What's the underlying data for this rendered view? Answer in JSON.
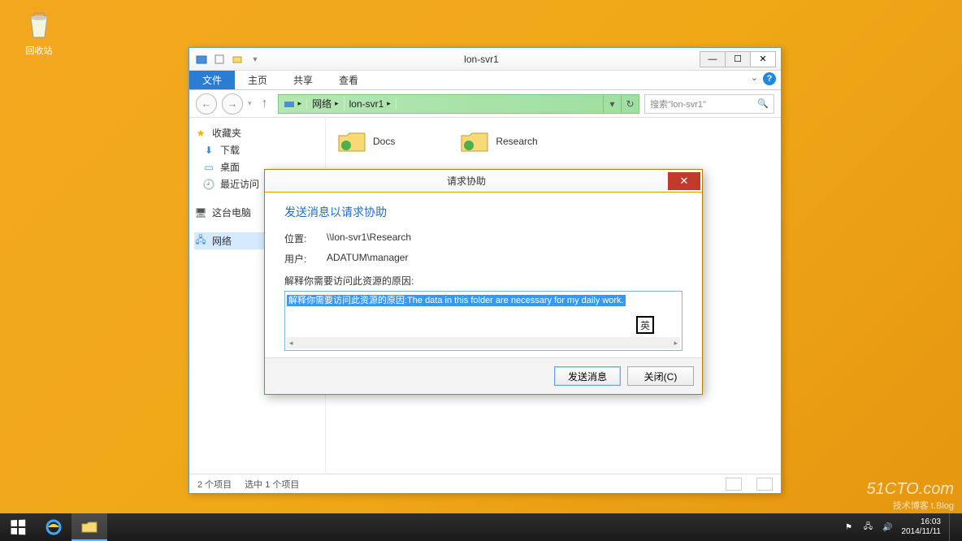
{
  "desktop": {
    "recycle_bin": "回收站"
  },
  "explorer": {
    "title": "lon-svr1",
    "ribbon": {
      "file": "文件",
      "home": "主页",
      "share": "共享",
      "view": "查看"
    },
    "addr": {
      "network": "网络",
      "host": "lon-svr1"
    },
    "search_placeholder": "搜索\"lon-svr1\"",
    "sidebar": {
      "favorites": "收藏夹",
      "downloads": "下载",
      "desktop": "桌面",
      "recent": "最近访问",
      "this_pc": "这台电脑",
      "network": "网络"
    },
    "folders": {
      "docs": "Docs",
      "research": "Research"
    },
    "status": {
      "count": "2 个项目",
      "selected": "选中 1 个项目"
    }
  },
  "dialog": {
    "title": "请求协助",
    "heading": "发送消息以请求协助",
    "loc_label": "位置:",
    "loc_value": "\\\\lon-svr1\\Research",
    "user_label": "用户:",
    "user_value": "ADATUM\\manager",
    "reason_label": "解释你需要访问此资源的原因:",
    "reason_text": "解释你需要访问此资源的原因:The data in this folder are necessary for my daily work.",
    "ime": "英",
    "send": "发送消息",
    "close": "关闭(C)"
  },
  "taskbar": {
    "time": "16:03",
    "date": "2014/11/11"
  },
  "watermark": {
    "l1": "51CTO.com",
    "l2": "技术博客 t.Blog"
  }
}
